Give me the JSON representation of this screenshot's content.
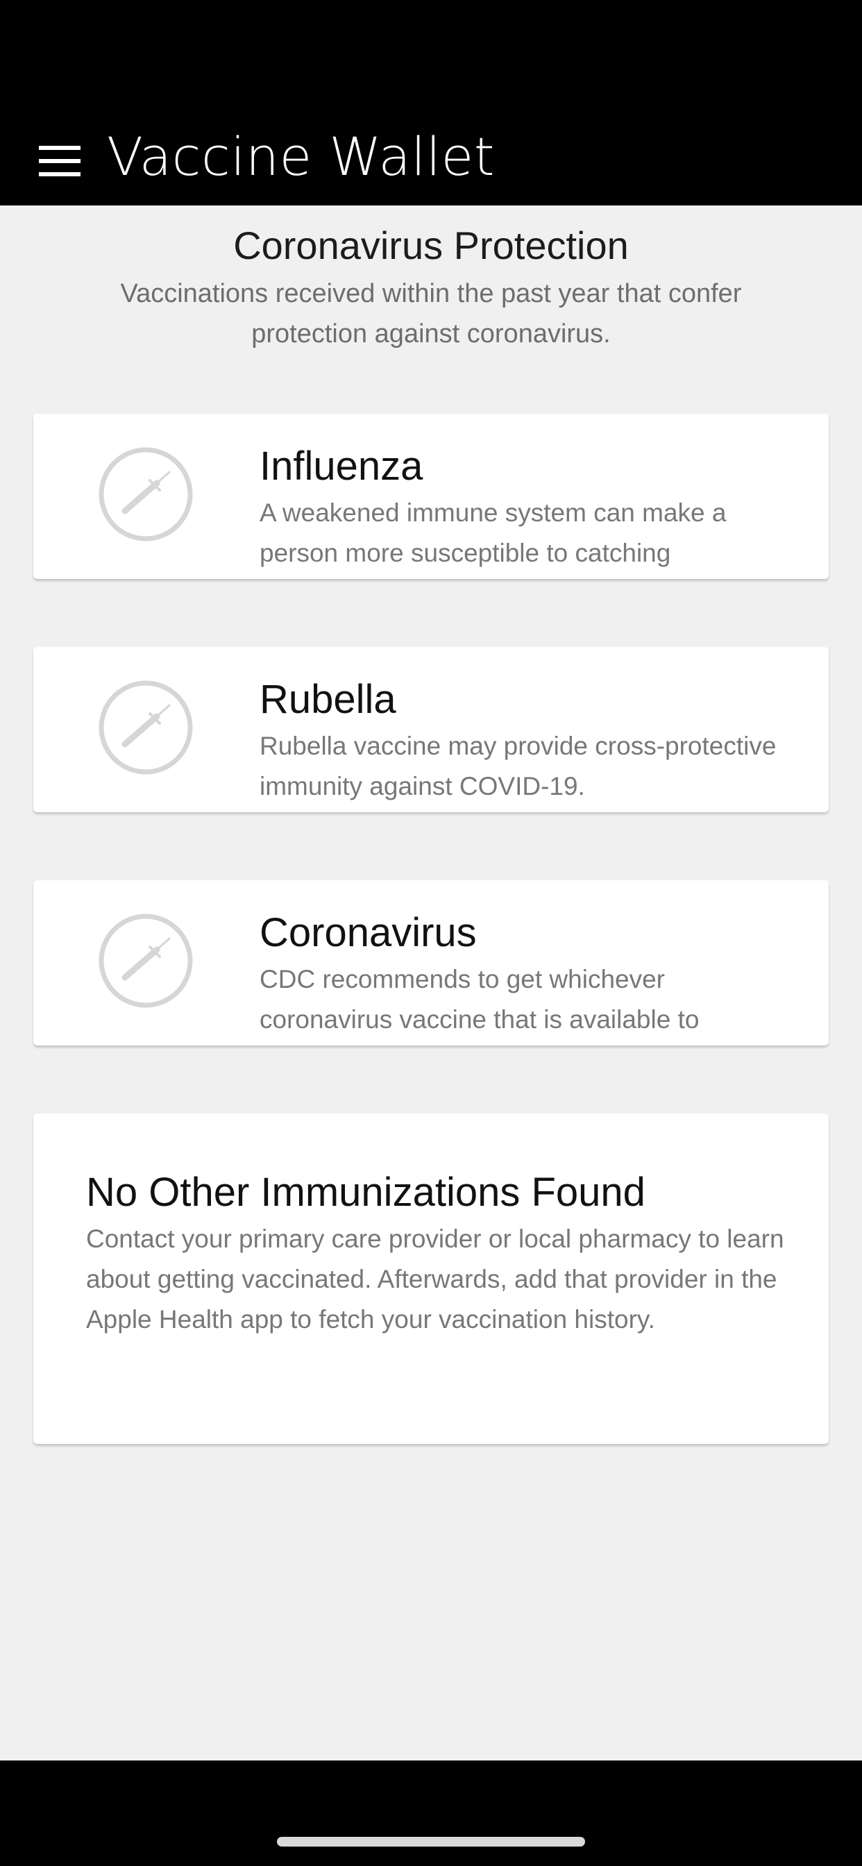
{
  "app": {
    "title": "Vaccine Wallet"
  },
  "section": {
    "title": "Coronavirus Protection",
    "subtitle": "Vaccinations received within the past year that confer protection against coronavirus."
  },
  "vaccines": [
    {
      "name": "Influenza",
      "description": "A weakened immune system can make a person more susceptible to catching",
      "icon": "syringe-icon"
    },
    {
      "name": "Rubella",
      "description": "Rubella vaccine may provide cross-protective immunity against COVID-19.",
      "icon": "syringe-icon"
    },
    {
      "name": "Coronavirus",
      "description": "CDC recommends to get whichever coronavirus vaccine that is available to",
      "icon": "syringe-icon"
    }
  ],
  "empty_state": {
    "title": "No Other Immunizations Found",
    "description": "Contact your primary care provider or local pharmacy to learn about getting vaccinated. Afterwards, add that provider in the Apple Health app to fetch your vaccination history."
  },
  "colors": {
    "header_bg": "#000000",
    "page_bg": "#f0f0f0",
    "card_bg": "#ffffff",
    "icon_gray": "#d6d6d6",
    "secondary_text": "#777777"
  }
}
